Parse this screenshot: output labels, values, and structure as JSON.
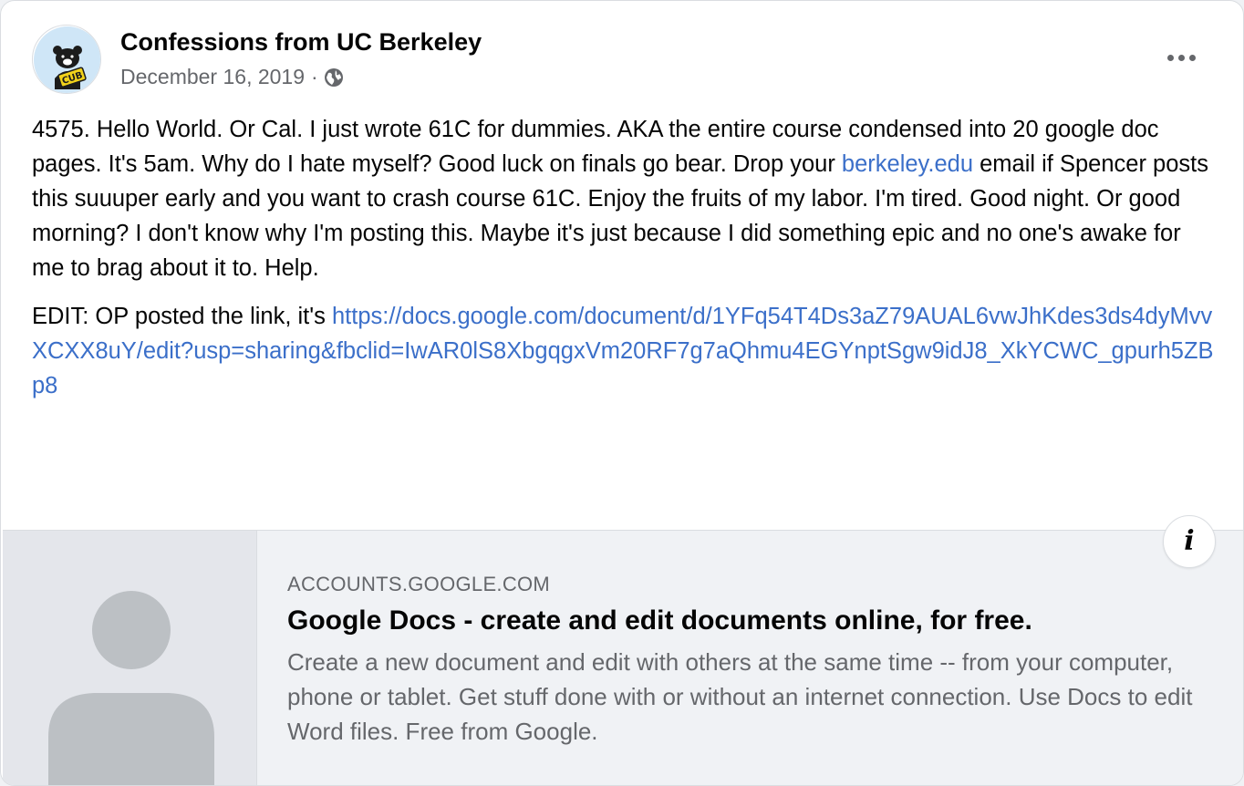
{
  "post": {
    "page_name": "Confessions from UC Berkeley",
    "date": "December 16, 2019",
    "separator": "·",
    "audience_icon": "globe-icon",
    "avatar_label": "CUB",
    "menu_icon": "more-options-icon",
    "body": {
      "p1_before_link": "4575. Hello World. Or Cal. I just wrote 61C for dummies. AKA the entire course condensed into 20 google doc pages. It's 5am. Why do I hate myself? Good luck on finals go bear. Drop your ",
      "p1_link": "berkeley.edu",
      "p1_after_link": " email if Spencer posts this suuuper early and you want to crash course 61C. Enjoy the fruits of my labor. I'm tired. Good night. Or good morning? I don't know why I'm posting this. Maybe it's just because I did something epic and no one's awake for me to brag about it to. Help.",
      "p2_text": "EDIT: OP posted the link, it's ",
      "p2_url": "https://docs.google.com/document/d/1YFq54T4Ds3aZ79AUAL6vwJhKdes3ds4dyMvvXCXX8uY/edit?usp=sharing&fbclid=IwAR0lS8XbgqgxVm20RF7g7aQhmu4EGYnptSgw9idJ8_XkYCWC_gpurh5ZBp8"
    }
  },
  "link_preview": {
    "domain": "ACCOUNTS.GOOGLE.COM",
    "title": "Google Docs - create and edit documents online, for free.",
    "description": "Create a new document and edit with others at the same time -- from your computer, phone or tablet. Get stuff done with or without an internet connection. Use Docs to edit Word files. Free from Google.",
    "thumbnail_icon": "default-person-placeholder-icon",
    "info_icon": "info-icon",
    "info_glyph": "i"
  },
  "colors": {
    "link": "#3b6fc9",
    "secondary_text": "#65676b",
    "primary_text": "#050505",
    "preview_bg": "#f0f2f5",
    "avatar_bg": "#cfe6f7",
    "avatar_badge": "#f2d21b"
  }
}
